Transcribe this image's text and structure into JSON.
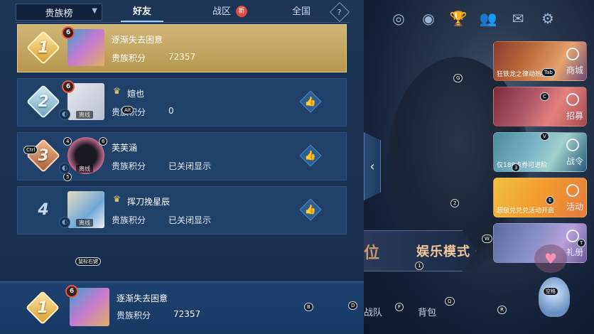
{
  "tabs": {
    "dropdown_label": "贵族榜",
    "items": [
      "好友",
      "战区",
      "全国"
    ],
    "new_badge": "新",
    "help": "?"
  },
  "rows": [
    {
      "rank": "1",
      "name": "逐渐失去困意",
      "score_label": "贵族积分",
      "score": "72357",
      "vip": "6",
      "is_me": true
    },
    {
      "rank": "2",
      "name": "媗也",
      "score_label": "贵族积分",
      "score": "0",
      "vip": "6",
      "status": "离线"
    },
    {
      "rank": "3",
      "name": "芙芙涵",
      "score_label": "贵族积分",
      "score": "已关闭显示",
      "status": "离线"
    },
    {
      "rank": "4",
      "name": "挥刀挽星辰",
      "score_label": "贵族积分",
      "score": "已关闭显示",
      "status": "离线"
    }
  ],
  "footer": {
    "rank": "1",
    "name": "逐渐失去困意",
    "score_label": "贵族积分",
    "score": "72357",
    "vip": "6"
  },
  "hotkeys": {
    "alt": "Alt",
    "ctrl": "Ctrl",
    "four": "4",
    "five": "5",
    "six": "6",
    "mouse_right": "鼠标右键",
    "tab": "Tab",
    "g": "G",
    "c": "C",
    "v": "V",
    "three": "3",
    "e": "E",
    "two": "2",
    "w": "W",
    "t": "T",
    "one": "1",
    "b": "B",
    "d": "D",
    "f": "F",
    "q": "Q",
    "r": "R",
    "space": "空格"
  },
  "side_cards": [
    {
      "caption": "狂铁龙之律动热卖",
      "tag": "商城"
    },
    {
      "caption": "",
      "tag": "招募"
    },
    {
      "caption": "仅188点券可进阶",
      "tag": "战令"
    },
    {
      "caption": "超级兑兑兑活动开启",
      "tag": "活动"
    },
    {
      "caption": "",
      "tag": "礼册"
    }
  ],
  "bottom_nav": {
    "pre": "位",
    "mode": "娱乐模式",
    "team": "战队",
    "bag": "背包"
  },
  "icons": {
    "top": [
      "target-icon",
      "eye-icon",
      "trophy-icon",
      "friends-icon",
      "mail-icon",
      "gear-icon"
    ],
    "like": "thumbs-up-icon",
    "collapse": "chevron-left-icon"
  },
  "colors": {
    "accent": "#9ed0ff",
    "gold_row": "#c8ab66",
    "badge_red": "#e04a3a"
  }
}
